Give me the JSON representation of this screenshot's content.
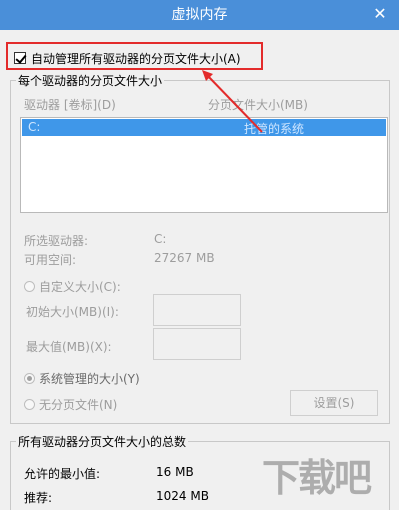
{
  "window": {
    "title": "虚拟内存",
    "close_glyph": "✕"
  },
  "auto_manage": {
    "label": "自动管理所有驱动器的分页文件大小(A)",
    "checked": true
  },
  "paging_group": {
    "title": "每个驱动器的分页文件大小",
    "col_drive": "驱动器 [卷标](D)",
    "col_size": "分页文件大小(MB)",
    "rows": [
      {
        "drive": "C:",
        "size": "托管的系统"
      }
    ],
    "selected_drive_label": "所选驱动器:",
    "selected_drive_value": "C:",
    "free_space_label": "可用空间:",
    "free_space_value": "27267 MB",
    "custom_size_label": "自定义大小(C):",
    "initial_size_label": "初始大小(MB)(I):",
    "max_size_label": "最大值(MB)(X):",
    "system_managed_label": "系统管理的大小(Y)",
    "no_paging_label": "无分页文件(N)",
    "set_button": "设置(S)"
  },
  "total_group": {
    "title": "所有驱动器分页文件大小的总数",
    "min_label": "允许的最小值:",
    "min_value": "16 MB",
    "recommended_label": "推荐:",
    "recommended_value": "1024 MB"
  },
  "colors": {
    "title_bar": "#4a8fd9",
    "annotation": "#e32b2b",
    "selection": "#3f97e9"
  }
}
